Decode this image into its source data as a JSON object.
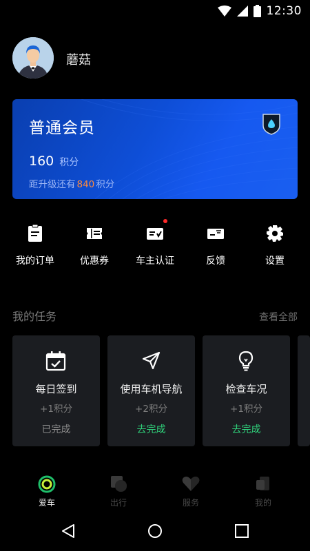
{
  "status_bar": {
    "time": "12:30",
    "icons": [
      "wifi-icon",
      "signal-icon",
      "battery-icon"
    ]
  },
  "profile": {
    "username": "蘑菇"
  },
  "member_card": {
    "level": "普通会员",
    "points_value": "160",
    "points_unit": "积分",
    "upgrade_prefix": "距升级还有",
    "upgrade_needed": "840",
    "upgrade_suffix": "积分",
    "accent_color": "#ff8a3d"
  },
  "actions": [
    {
      "label": "我的订单",
      "icon": "order-icon"
    },
    {
      "label": "优惠券",
      "icon": "coupon-icon"
    },
    {
      "label": "车主认证",
      "icon": "owner-certification-icon"
    },
    {
      "label": "反馈",
      "icon": "feedback-icon"
    },
    {
      "label": "设置",
      "icon": "gear-icon"
    }
  ],
  "tasks": {
    "title": "我的任务",
    "view_all": "查看全部",
    "items": [
      {
        "title": "每日签到",
        "points": "+1积分",
        "state": "已完成",
        "icon": "calendar-check-icon"
      },
      {
        "title": "使用车机导航",
        "points": "+2积分",
        "state": "去完成",
        "icon": "navigation-icon"
      },
      {
        "title": "检查车况",
        "points": "+1积分",
        "state": "去完成",
        "icon": "lightbulb-icon"
      }
    ],
    "done_color": "#8a8a8a",
    "todo_color": "#2fd07a"
  },
  "tabbar": [
    {
      "label": "爱车",
      "icon": "car-ring-icon",
      "active": true
    },
    {
      "label": "出行",
      "icon": "trip-icon",
      "active": false
    },
    {
      "label": "服务",
      "icon": "heart-service-icon",
      "active": false
    },
    {
      "label": "我的",
      "icon": "profile-icon",
      "active": false
    }
  ],
  "system_nav": [
    "back-icon",
    "home-icon",
    "recents-icon"
  ]
}
